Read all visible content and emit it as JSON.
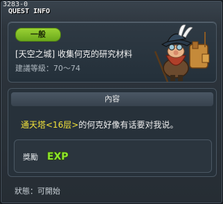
{
  "window": {
    "id": "3283-0",
    "title": "QUEST INFO"
  },
  "quest": {
    "category_badge": "一般",
    "name": "[天空之城] 收集何克的研究材料",
    "level_label": "建議等級：",
    "level_range": "70～74"
  },
  "content": {
    "header": "內容",
    "description_highlight": "通天塔<16层>",
    "description_rest": "的何克好像有话要对我说。",
    "reward_label": "獎勵",
    "reward_icon": "exp-icon"
  },
  "status": {
    "label": "狀態：",
    "value": "可開始"
  },
  "colors": {
    "badge_green": "#8cc63f",
    "highlight_yellow": "#f3e23a",
    "exp_green": "#8ee62c"
  }
}
